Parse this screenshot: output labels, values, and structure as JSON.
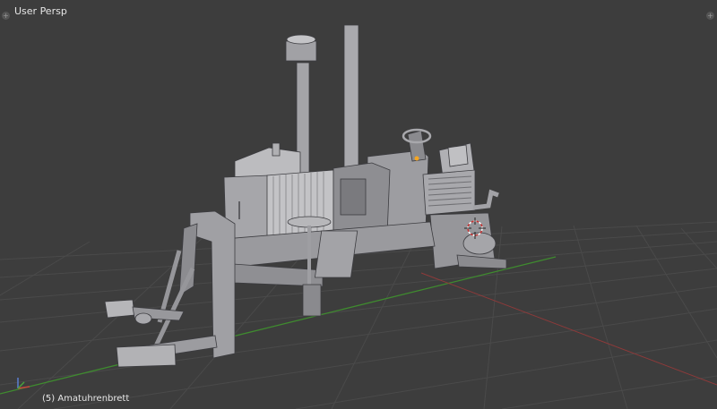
{
  "viewport": {
    "view_name": "User Persp",
    "active_object_label": "(5) Amatuhrenbrett",
    "corner_widget_symbol": "+"
  },
  "colors": {
    "background": "#3d3d3d",
    "grid": "#4a4a4a",
    "x_axis": "#8e3a3a",
    "y_axis": "#3f8b2f",
    "model_light": "#b4b4b6",
    "model_mid": "#8d8d90",
    "model_dark": "#5e5e62"
  },
  "icons": [
    "split-area-widget-icon",
    "3d-cursor-icon",
    "axis-gizmo-icon",
    "tractor-model"
  ]
}
